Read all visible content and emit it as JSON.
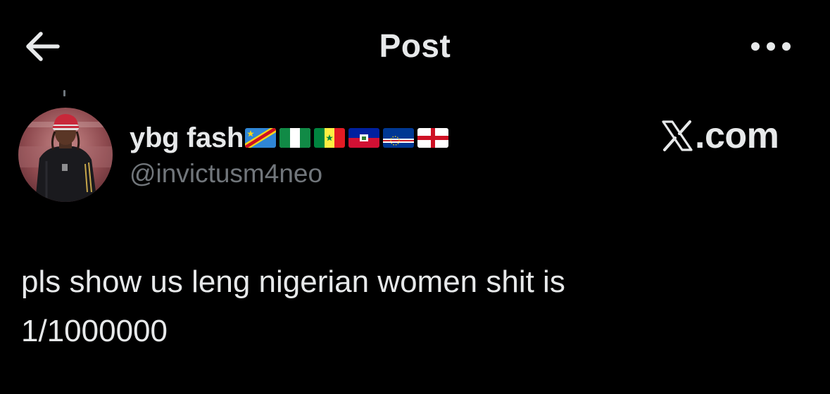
{
  "header": {
    "title": "Post",
    "back_icon": "arrow-left-icon",
    "more_icon": "more-horizontal-icon"
  },
  "author": {
    "display_name": "ybg fash",
    "handle": "@invictusm4neo",
    "flags": [
      "DR Congo",
      "Nigeria",
      "Senegal",
      "Haiti",
      "Cape Verde",
      "England"
    ]
  },
  "watermark": {
    "text": ".com",
    "logo_icon": "x-logo-icon"
  },
  "post": {
    "text": "pls show us leng nigerian women shit is\n1/1000000"
  },
  "colors": {
    "background": "#000000",
    "primary_text": "#e7e9ea",
    "secondary_text": "#71767b"
  }
}
